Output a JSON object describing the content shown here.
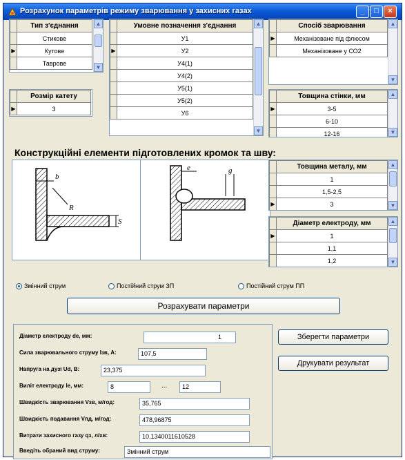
{
  "window": {
    "title": "Розрахунок параметрів режиму зварювання у захисних газах",
    "minimize_glyph": "_",
    "maximize_glyph": "□",
    "close_glyph": "×"
  },
  "joint_type": {
    "header": "Тип з'єднання",
    "rows": [
      "Стикове",
      "Кутове",
      "Таврове"
    ],
    "selected_index": 1
  },
  "leg_size": {
    "header": "Розмір катету",
    "rows": [
      "3"
    ]
  },
  "joint_designation": {
    "header": "Умовне позначення з'єднання",
    "rows": [
      "У1",
      "У2",
      "У4(1)",
      "У4(2)",
      "У5(1)",
      "У5(2)",
      "У6"
    ],
    "selected_index": 1
  },
  "welding_method": {
    "header": "Спосіб зварювання",
    "rows": [
      "Механізоване під флюсом",
      "Механізоване у СО2"
    ],
    "selected_index": 0
  },
  "wall_thickness": {
    "header": "Товщина стінки, мм",
    "rows": [
      "3-5",
      "6-10",
      "12-16"
    ],
    "selected_index": 0
  },
  "section_title": "Конструкційні елементи підготовлених кромок та шву:",
  "drawing": {
    "left_labels": [
      "b",
      "R",
      "S"
    ],
    "right_labels": [
      "e",
      "g"
    ]
  },
  "metal_thickness": {
    "header": "Товщина металу, мм",
    "rows": [
      "1",
      "1,5-2,5",
      "3"
    ],
    "selected_index": 2
  },
  "electrode_diameter_grid": {
    "header": "Діаметр електроду, мм",
    "rows": [
      "1",
      "1,1",
      "1,2"
    ],
    "selected_index": 0
  },
  "current_type": {
    "options": [
      "Змінний струм",
      "Постійний струм ЗП",
      "Постійний струм ПП"
    ],
    "selected_index": 0
  },
  "buttons": {
    "calculate": "Розрахувати параметри",
    "save": "Зберегти параметри",
    "print": "Друкувати результат"
  },
  "results": {
    "electrode_diameter": {
      "label": "Діаметр електроду dе, мм:",
      "value": "1"
    },
    "welding_current": {
      "label": "Сила зварювального струму Ізв, А:",
      "value": "107,5"
    },
    "arc_voltage": {
      "label": "Напруга на дузі Ud, В:",
      "value": "23,375"
    },
    "electrode_stickout": {
      "label": "Виліт електроду lе, мм:",
      "min": "8",
      "separator": "...",
      "max": "12"
    },
    "welding_speed": {
      "label": "Швидкість зварювання Vзв, м/год:",
      "value": "35,765"
    },
    "feed_speed": {
      "label": "Швидкість подавання Vпд, м/год:",
      "value": "478,96875"
    },
    "gas_consumption": {
      "label": "Витрати захисного газу qз, л/хв:",
      "value": "10,1340011610528"
    },
    "current_kind": {
      "label": "Введіть обраний вид струму:",
      "value": "Змінний струм"
    }
  },
  "indicator_glyph": "▶",
  "scroll_up_glyph": "▲",
  "scroll_down_glyph": "▼"
}
